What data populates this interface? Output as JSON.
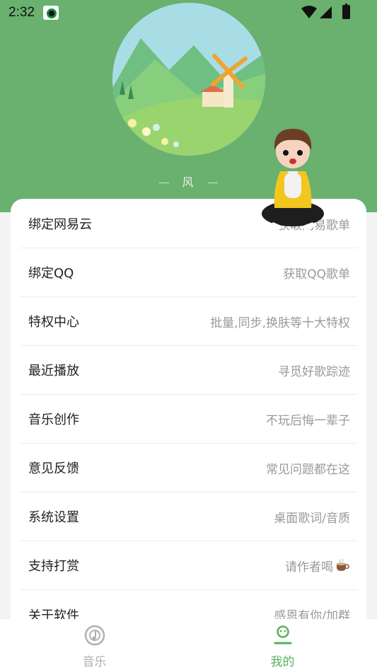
{
  "status_bar": {
    "time": "2:32"
  },
  "profile": {
    "nickname": "风"
  },
  "menu": [
    {
      "label": "绑定网易云",
      "desc": "获取网易歌单"
    },
    {
      "label": "绑定QQ",
      "desc": "获取QQ歌单"
    },
    {
      "label": "特权中心",
      "desc": "批量,同步,换肤等十大特权"
    },
    {
      "label": "最近播放",
      "desc": "寻觅好歌踪迹"
    },
    {
      "label": "音乐创作",
      "desc": "不玩后悔一辈子"
    },
    {
      "label": "意见反馈",
      "desc": "常见问题都在这"
    },
    {
      "label": "系统设置",
      "desc": "桌面歌词/音质"
    },
    {
      "label": "支持打赏",
      "desc": "请作者喝"
    },
    {
      "label": "关于软件",
      "desc": "感恩有你/加群"
    }
  ],
  "tabs": [
    {
      "label": "音乐",
      "icon": "music-disc-icon",
      "color": "#b0b0b0"
    },
    {
      "label": "我的",
      "icon": "user-icon",
      "color": "#56b05c"
    }
  ],
  "colors": {
    "header": "#6ab06f",
    "accent": "#56b05c"
  }
}
